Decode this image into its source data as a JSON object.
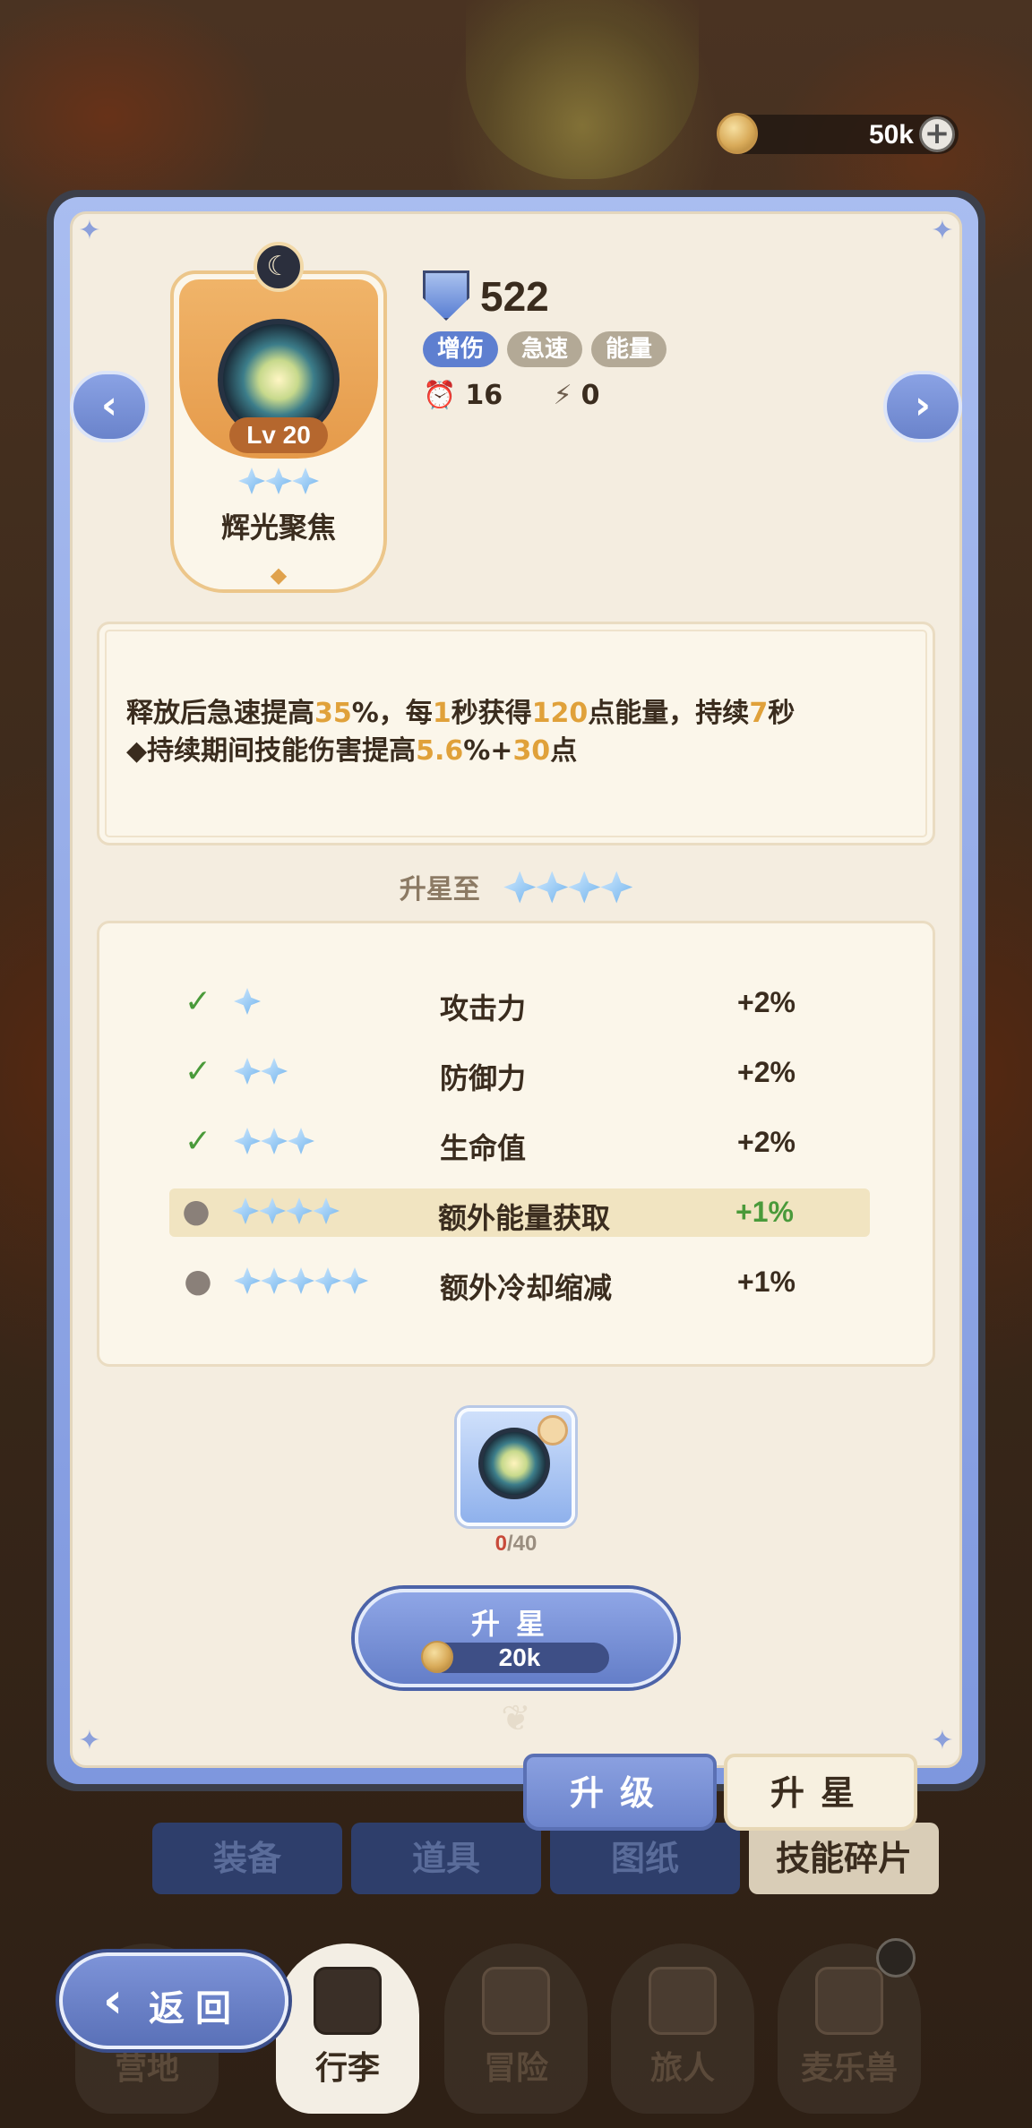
{
  "currency": {
    "amount": "50k"
  },
  "skill": {
    "level_label": "Lv 20",
    "stars": 3,
    "name": "辉光聚焦",
    "power": "522",
    "tags": [
      "增伤",
      "急速",
      "能量"
    ],
    "cooldown": "16",
    "energy": "0"
  },
  "description": {
    "line1": [
      {
        "t": "释放后急速提高"
      },
      {
        "t": "35",
        "hl": true
      },
      {
        "t": "%，每"
      },
      {
        "t": "1",
        "hl": true
      },
      {
        "t": "秒获得"
      },
      {
        "t": "120",
        "hl": true
      },
      {
        "t": "点能量，持续"
      },
      {
        "t": "7",
        "hl": true
      },
      {
        "t": "秒"
      }
    ],
    "line2": [
      {
        "t": "◆持续期间技能伤害提高"
      },
      {
        "t": "5.6",
        "hl": true
      },
      {
        "t": "%+"
      },
      {
        "t": "30",
        "hl": true
      },
      {
        "t": "点"
      }
    ]
  },
  "upgrade": {
    "heading": "升星至",
    "target_stars": 4,
    "rows": [
      {
        "stars": 1,
        "name": "攻击力",
        "value": "+2%",
        "status": "done"
      },
      {
        "stars": 2,
        "name": "防御力",
        "value": "+2%",
        "status": "done"
      },
      {
        "stars": 3,
        "name": "生命值",
        "value": "+2%",
        "status": "done"
      },
      {
        "stars": 4,
        "name": "额外能量获取",
        "value": "+1%",
        "status": "next"
      },
      {
        "stars": 5,
        "name": "额外冷却缩减",
        "value": "+1%",
        "status": "locked"
      }
    ]
  },
  "material": {
    "have": "0",
    "need": "/40"
  },
  "starup_button": {
    "label": "升星",
    "cost": "20k"
  },
  "panel_tabs": {
    "upgrade": "升级",
    "star": "升星"
  },
  "under_tabs": [
    "装备",
    "道具",
    "图纸",
    "技能碎片"
  ],
  "bottom_nav": {
    "back": "返回",
    "items": [
      "营地",
      "行李",
      "冒险",
      "旅人",
      "麦乐兽"
    ]
  }
}
